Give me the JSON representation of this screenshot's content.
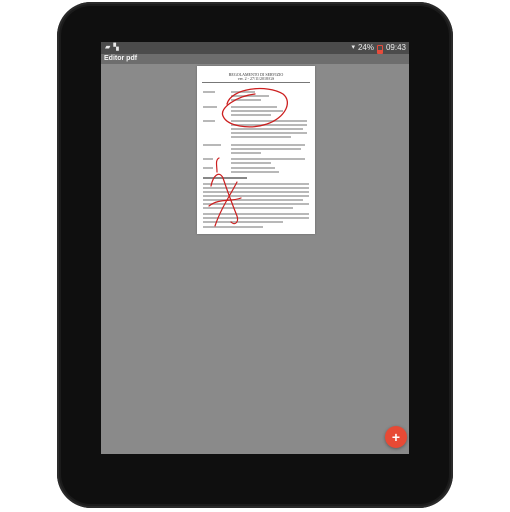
{
  "status_bar": {
    "notification_icons": [
      "image-icon",
      "flipboard-icon"
    ],
    "wifi_icon": "wifi-icon",
    "battery_text": "24%",
    "battery_icon": "battery-icon",
    "time": "09:43"
  },
  "app_bar": {
    "title": "Editor pdf"
  },
  "document": {
    "header_line1": "REGOLAMENTO DI SERVIZIO",
    "header_line2": "ver. 2 - 27/11/2018/GS",
    "annotation_color": "#cc1f1f"
  },
  "fab": {
    "label": "+",
    "color": "#e74a35"
  },
  "colors": {
    "screen_bg": "#8a8a8a",
    "status_bar": "#4b4b4b",
    "app_bar": "#6d6d6d"
  }
}
